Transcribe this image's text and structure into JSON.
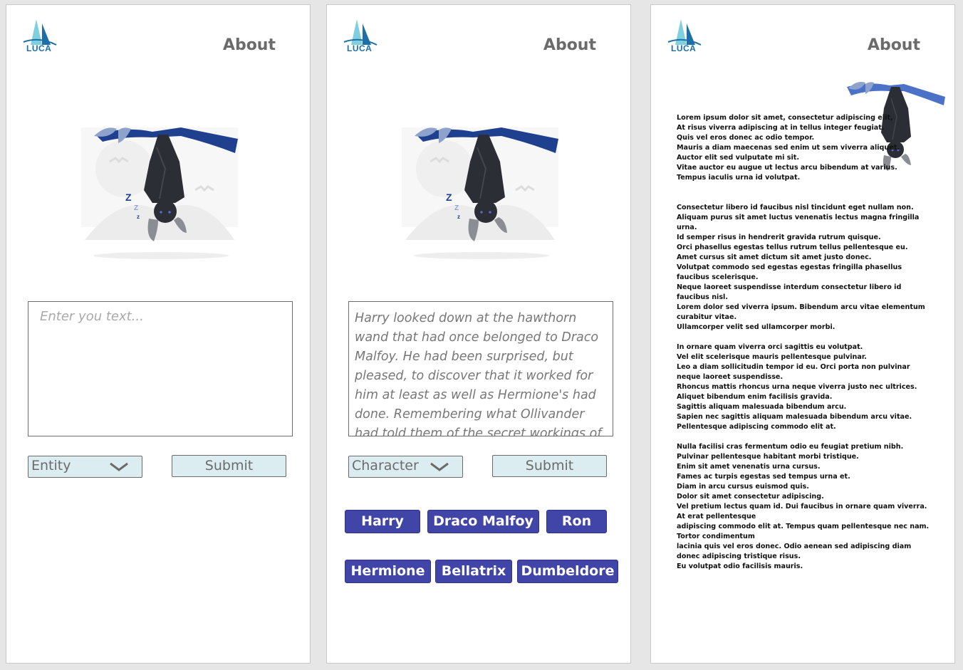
{
  "brand": {
    "name": "LUCA"
  },
  "header": {
    "about_label": "About"
  },
  "screens": [
    {
      "textarea": {
        "placeholder": "Enter you text..."
      },
      "select": {
        "value": "Entity"
      },
      "submit_label": "Submit"
    },
    {
      "textarea": {
        "value": "Harry looked down at the hawthorn wand that had once belonged to Draco Malfoy. He had been surprised, but pleased, to discover that it worked for him at least as well as Hermione's had done. Remembering what Ollivander had told them of the secret workings of wands, Harry"
      },
      "select": {
        "value": "Character"
      },
      "submit_label": "Submit",
      "chips": [
        "Harry",
        "Draco Malfoy",
        "Ron",
        "Hermione",
        "Bellatrix",
        "Dumbeldore"
      ]
    },
    {
      "paragraphs": [
        [
          "Lorem ipsum dolor sit amet, consectetur adipiscing elit,",
          "At risus viverra adipiscing at in tellus integer feugiat.",
          "Quis vel eros donec ac odio tempor.",
          "Mauris a diam maecenas sed enim ut sem viverra aliquet.",
          "Auctor elit sed vulputate mi sit.",
          "Vitae auctor eu augue ut lectus arcu bibendum at varius.",
          "Tempus iaculis urna id volutpat."
        ],
        [
          "Consectetur libero id faucibus nisl tincidunt eget nullam non.",
          "Aliquam purus sit amet luctus venenatis lectus magna fringilla urna.",
          "Id semper risus in hendrerit gravida rutrum quisque.",
          "Orci phasellus egestas tellus rutrum tellus pellentesque eu.",
          "Amet cursus sit amet dictum sit amet justo donec.",
          "Volutpat commodo sed egestas egestas fringilla phasellus faucibus scelerisque.",
          "Neque laoreet suspendisse interdum consectetur libero id faucibus nisl.",
          "Lorem dolor sed viverra ipsum. Bibendum arcu vitae elementum curabitur vitae.",
          "Ullamcorper velit sed ullamcorper morbi."
        ],
        [
          "In ornare quam viverra orci sagittis eu volutpat.",
          "Vel elit scelerisque mauris pellentesque pulvinar.",
          "Leo a diam sollicitudin tempor id eu. Orci porta non pulvinar neque laoreet suspendisse.",
          "Rhoncus mattis rhoncus urna neque viverra justo nec ultrices.",
          "Aliquet bibendum enim facilisis gravida.",
          "Sagittis aliquam malesuada bibendum arcu.",
          "Sapien nec sagittis aliquam malesuada bibendum arcu vitae.",
          "Pellentesque adipiscing commodo elit at."
        ],
        [
          "Nulla facilisi cras fermentum odio eu feugiat pretium nibh.",
          "Pulvinar pellentesque habitant morbi tristique.",
          "Enim sit amet venenatis urna cursus.",
          "Fames ac turpis egestas sed tempus urna et.",
          "Diam in arcu cursus euismod quis.",
          "Dolor sit amet consectetur adipiscing.",
          "Vel pretium lectus quam id. Dui faucibus in ornare quam viverra. At erat pellentesque",
          "adipiscing commodo elit at. Tempus quam pellentesque nec nam. Tortor condimentum",
          " lacinia quis vel eros donec. Odio aenean sed adipiscing diam donec adipiscing tristique risus.",
          " Eu volutpat odio facilisis mauris."
        ]
      ]
    }
  ],
  "colors": {
    "chip_bg": "#4245a8",
    "control_bg": "#dcedf2",
    "logo_blue": "#1d6fa8",
    "wing_blue": "#1f3f8f"
  }
}
